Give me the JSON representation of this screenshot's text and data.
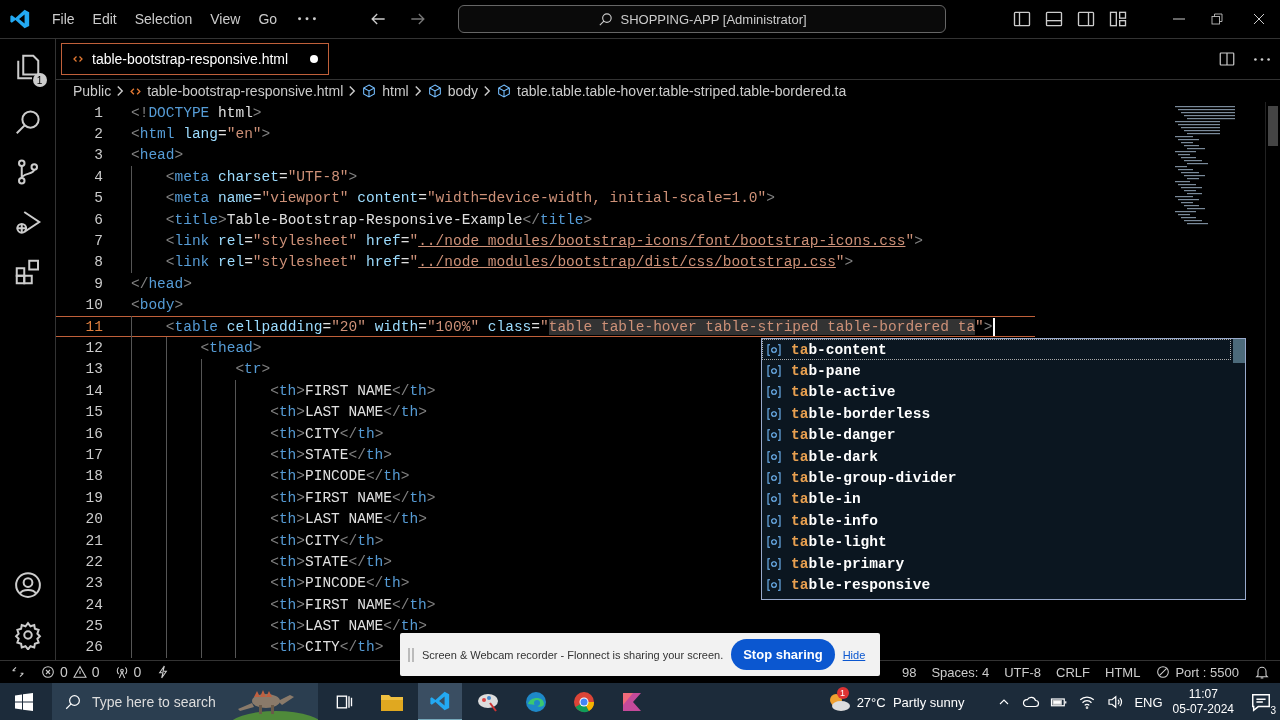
{
  "title_bar": {
    "menu": [
      "File",
      "Edit",
      "Selection",
      "View",
      "Go"
    ],
    "command_center": "SHOPPING-APP [Administrator]"
  },
  "activity_bar": {
    "explorer_badge": "1"
  },
  "tabs": [
    {
      "label": "table-bootstrap-responsive.html",
      "selected": true,
      "modified": true
    }
  ],
  "breadcrumb": [
    {
      "kind": "folder",
      "label": "Public"
    },
    {
      "kind": "file",
      "label": "table-bootstrap-responsive.html"
    },
    {
      "kind": "element",
      "label": "html"
    },
    {
      "kind": "element",
      "label": "body"
    },
    {
      "kind": "element",
      "label": "table.table.table-hover.table-striped.table-bordered.ta"
    }
  ],
  "lines": [
    {
      "number": "1",
      "current": false,
      "tokens": [
        {
          "kind": "punct",
          "text": "<!"
        },
        {
          "kind": "tag",
          "text": "DOCTYPE"
        },
        {
          "kind": "text",
          "text": " html"
        },
        {
          "kind": "punct",
          "text": ">"
        }
      ]
    },
    {
      "number": "2",
      "current": false,
      "tokens": [
        {
          "kind": "punct",
          "text": "<"
        },
        {
          "kind": "tag",
          "text": "html"
        },
        {
          "kind": "attr",
          "text": " lang"
        },
        {
          "kind": "text",
          "text": "="
        },
        {
          "kind": "str",
          "text": "\"en\""
        },
        {
          "kind": "punct",
          "text": ">"
        }
      ]
    },
    {
      "number": "3",
      "current": false,
      "tokens": [
        {
          "kind": "punct",
          "text": "<"
        },
        {
          "kind": "tag",
          "text": "head"
        },
        {
          "kind": "punct",
          "text": ">"
        }
      ],
      "children": [
        {
          "number": "4",
          "current": false,
          "tokens": [
            {
              "kind": "punct",
              "text": "<"
            },
            {
              "kind": "tag",
              "text": "meta"
            },
            {
              "kind": "attr",
              "text": " charset"
            },
            {
              "kind": "text",
              "text": "="
            },
            {
              "kind": "str",
              "text": "\"UTF-8\""
            },
            {
              "kind": "punct",
              "text": ">"
            }
          ]
        },
        {
          "number": "5",
          "current": false,
          "tokens": [
            {
              "kind": "punct",
              "text": "<"
            },
            {
              "kind": "tag",
              "text": "meta"
            },
            {
              "kind": "attr",
              "text": " name"
            },
            {
              "kind": "text",
              "text": "="
            },
            {
              "kind": "str",
              "text": "\"viewport\""
            },
            {
              "kind": "attr",
              "text": " content"
            },
            {
              "kind": "text",
              "text": "="
            },
            {
              "kind": "str",
              "text": "\"width=device-width, initial-scale=1.0\""
            },
            {
              "kind": "punct",
              "text": ">"
            }
          ]
        },
        {
          "number": "6",
          "current": false,
          "tokens": [
            {
              "kind": "punct",
              "text": "<"
            },
            {
              "kind": "tag",
              "text": "title"
            },
            {
              "kind": "punct",
              "text": ">"
            },
            {
              "kind": "text",
              "text": "Table-Bootstrap-Responsive-Example"
            },
            {
              "kind": "punct",
              "text": "</"
            },
            {
              "kind": "tag",
              "text": "title"
            },
            {
              "kind": "punct",
              "text": ">"
            }
          ]
        },
        {
          "number": "7",
          "current": false,
          "tokens": [
            {
              "kind": "punct",
              "text": "<"
            },
            {
              "kind": "tag",
              "text": "link"
            },
            {
              "kind": "attr",
              "text": " rel"
            },
            {
              "kind": "text",
              "text": "="
            },
            {
              "kind": "str",
              "text": "\"stylesheet\""
            },
            {
              "kind": "attr",
              "text": " href"
            },
            {
              "kind": "text",
              "text": "="
            },
            {
              "kind": "str",
              "text": "\""
            },
            {
              "kind": "link",
              "text": "../node_modules/bootstrap-icons/font/bootstrap-icons.css"
            },
            {
              "kind": "str",
              "text": "\""
            },
            {
              "kind": "punct",
              "text": ">"
            }
          ]
        },
        {
          "number": "8",
          "current": false,
          "tokens": [
            {
              "kind": "punct",
              "text": "<"
            },
            {
              "kind": "tag",
              "text": "link"
            },
            {
              "kind": "attr",
              "text": " rel"
            },
            {
              "kind": "text",
              "text": "="
            },
            {
              "kind": "str",
              "text": "\"stylesheet\""
            },
            {
              "kind": "attr",
              "text": " href"
            },
            {
              "kind": "text",
              "text": "="
            },
            {
              "kind": "str",
              "text": "\""
            },
            {
              "kind": "link",
              "text": "../node_modules/bootstrap/dist/css/bootstrap.css"
            },
            {
              "kind": "str",
              "text": "\""
            },
            {
              "kind": "punct",
              "text": ">"
            }
          ]
        }
      ]
    },
    {
      "number": "9",
      "current": false,
      "tokens": [
        {
          "kind": "punct",
          "text": "</"
        },
        {
          "kind": "tag",
          "text": "head"
        },
        {
          "kind": "punct",
          "text": ">"
        }
      ]
    },
    {
      "number": "10",
      "current": false,
      "tokens": [
        {
          "kind": "punct",
          "text": "<"
        },
        {
          "kind": "tag",
          "text": "body"
        },
        {
          "kind": "punct",
          "text": ">"
        }
      ],
      "children": [
        {
          "number": "11",
          "current": true,
          "tokens": [
            {
              "kind": "punct",
              "text": "<"
            },
            {
              "kind": "tag",
              "text": "table"
            },
            {
              "kind": "attr",
              "text": " cellpadding"
            },
            {
              "kind": "text",
              "text": "="
            },
            {
              "kind": "str",
              "text": "\"20\""
            },
            {
              "kind": "attr",
              "text": " width"
            },
            {
              "kind": "text",
              "text": "="
            },
            {
              "kind": "str",
              "text": "\"100%\""
            },
            {
              "kind": "attr",
              "text": " class"
            },
            {
              "kind": "text",
              "text": "="
            },
            {
              "kind": "str",
              "text": "\""
            },
            {
              "kind": "highlight",
              "text": "table table-hover table-striped table-bordered ta"
            },
            {
              "kind": "str",
              "text": "\""
            },
            {
              "kind": "punct",
              "text": ">"
            }
          ],
          "children": [
            {
              "number": "12",
              "current": false,
              "tokens": [
                {
                  "kind": "punct",
                  "text": "<"
                },
                {
                  "kind": "tag",
                  "text": "thead"
                },
                {
                  "kind": "punct",
                  "text": ">"
                }
              ],
              "children": [
                {
                  "number": "13",
                  "current": false,
                  "tokens": [
                    {
                      "kind": "punct",
                      "text": "<"
                    },
                    {
                      "kind": "tag",
                      "text": "tr"
                    },
                    {
                      "kind": "punct",
                      "text": ">"
                    }
                  ],
                  "children": [
                    {
                      "number": "14",
                      "current": false,
                      "tokens": [
                        {
                          "kind": "punct",
                          "text": "<"
                        },
                        {
                          "kind": "tag",
                          "text": "th"
                        },
                        {
                          "kind": "punct",
                          "text": ">"
                        },
                        {
                          "kind": "text",
                          "text": "FIRST NAME"
                        },
                        {
                          "kind": "punct",
                          "text": "</"
                        },
                        {
                          "kind": "tag",
                          "text": "th"
                        },
                        {
                          "kind": "punct",
                          "text": ">"
                        }
                      ]
                    },
                    {
                      "number": "15",
                      "current": false,
                      "tokens": [
                        {
                          "kind": "punct",
                          "text": "<"
                        },
                        {
                          "kind": "tag",
                          "text": "th"
                        },
                        {
                          "kind": "punct",
                          "text": ">"
                        },
                        {
                          "kind": "text",
                          "text": "LAST NAME"
                        },
                        {
                          "kind": "punct",
                          "text": "</"
                        },
                        {
                          "kind": "tag",
                          "text": "th"
                        },
                        {
                          "kind": "punct",
                          "text": ">"
                        }
                      ]
                    },
                    {
                      "number": "16",
                      "current": false,
                      "tokens": [
                        {
                          "kind": "punct",
                          "text": "<"
                        },
                        {
                          "kind": "tag",
                          "text": "th"
                        },
                        {
                          "kind": "punct",
                          "text": ">"
                        },
                        {
                          "kind": "text",
                          "text": "CITY"
                        },
                        {
                          "kind": "punct",
                          "text": "</"
                        },
                        {
                          "kind": "tag",
                          "text": "th"
                        },
                        {
                          "kind": "punct",
                          "text": ">"
                        }
                      ]
                    },
                    {
                      "number": "17",
                      "current": false,
                      "tokens": [
                        {
                          "kind": "punct",
                          "text": "<"
                        },
                        {
                          "kind": "tag",
                          "text": "th"
                        },
                        {
                          "kind": "punct",
                          "text": ">"
                        },
                        {
                          "kind": "text",
                          "text": "STATE"
                        },
                        {
                          "kind": "punct",
                          "text": "</"
                        },
                        {
                          "kind": "tag",
                          "text": "th"
                        },
                        {
                          "kind": "punct",
                          "text": ">"
                        }
                      ]
                    },
                    {
                      "number": "18",
                      "current": false,
                      "tokens": [
                        {
                          "kind": "punct",
                          "text": "<"
                        },
                        {
                          "kind": "tag",
                          "text": "th"
                        },
                        {
                          "kind": "punct",
                          "text": ">"
                        },
                        {
                          "kind": "text",
                          "text": "PINCODE"
                        },
                        {
                          "kind": "punct",
                          "text": "</"
                        },
                        {
                          "kind": "tag",
                          "text": "th"
                        },
                        {
                          "kind": "punct",
                          "text": ">"
                        }
                      ]
                    },
                    {
                      "number": "19",
                      "current": false,
                      "tokens": [
                        {
                          "kind": "punct",
                          "text": "<"
                        },
                        {
                          "kind": "tag",
                          "text": "th"
                        },
                        {
                          "kind": "punct",
                          "text": ">"
                        },
                        {
                          "kind": "text",
                          "text": "FIRST NAME"
                        },
                        {
                          "kind": "punct",
                          "text": "</"
                        },
                        {
                          "kind": "tag",
                          "text": "th"
                        },
                        {
                          "kind": "punct",
                          "text": ">"
                        }
                      ]
                    },
                    {
                      "number": "20",
                      "current": false,
                      "tokens": [
                        {
                          "kind": "punct",
                          "text": "<"
                        },
                        {
                          "kind": "tag",
                          "text": "th"
                        },
                        {
                          "kind": "punct",
                          "text": ">"
                        },
                        {
                          "kind": "text",
                          "text": "LAST NAME"
                        },
                        {
                          "kind": "punct",
                          "text": "</"
                        },
                        {
                          "kind": "tag",
                          "text": "th"
                        },
                        {
                          "kind": "punct",
                          "text": ">"
                        }
                      ]
                    },
                    {
                      "number": "21",
                      "current": false,
                      "tokens": [
                        {
                          "kind": "punct",
                          "text": "<"
                        },
                        {
                          "kind": "tag",
                          "text": "th"
                        },
                        {
                          "kind": "punct",
                          "text": ">"
                        },
                        {
                          "kind": "text",
                          "text": "CITY"
                        },
                        {
                          "kind": "punct",
                          "text": "</"
                        },
                        {
                          "kind": "tag",
                          "text": "th"
                        },
                        {
                          "kind": "punct",
                          "text": ">"
                        }
                      ]
                    },
                    {
                      "number": "22",
                      "current": false,
                      "tokens": [
                        {
                          "kind": "punct",
                          "text": "<"
                        },
                        {
                          "kind": "tag",
                          "text": "th"
                        },
                        {
                          "kind": "punct",
                          "text": ">"
                        },
                        {
                          "kind": "text",
                          "text": "STATE"
                        },
                        {
                          "kind": "punct",
                          "text": "</"
                        },
                        {
                          "kind": "tag",
                          "text": "th"
                        },
                        {
                          "kind": "punct",
                          "text": ">"
                        }
                      ]
                    },
                    {
                      "number": "23",
                      "current": false,
                      "tokens": [
                        {
                          "kind": "punct",
                          "text": "<"
                        },
                        {
                          "kind": "tag",
                          "text": "th"
                        },
                        {
                          "kind": "punct",
                          "text": ">"
                        },
                        {
                          "kind": "text",
                          "text": "PINCODE"
                        },
                        {
                          "kind": "punct",
                          "text": "</"
                        },
                        {
                          "kind": "tag",
                          "text": "th"
                        },
                        {
                          "kind": "punct",
                          "text": ">"
                        }
                      ]
                    },
                    {
                      "number": "24",
                      "current": false,
                      "tokens": [
                        {
                          "kind": "punct",
                          "text": "<"
                        },
                        {
                          "kind": "tag",
                          "text": "th"
                        },
                        {
                          "kind": "punct",
                          "text": ">"
                        },
                        {
                          "kind": "text",
                          "text": "FIRST NAME"
                        },
                        {
                          "kind": "punct",
                          "text": "</"
                        },
                        {
                          "kind": "tag",
                          "text": "th"
                        },
                        {
                          "kind": "punct",
                          "text": ">"
                        }
                      ]
                    },
                    {
                      "number": "25",
                      "current": false,
                      "tokens": [
                        {
                          "kind": "punct",
                          "text": "<"
                        },
                        {
                          "kind": "tag",
                          "text": "th"
                        },
                        {
                          "kind": "punct",
                          "text": ">"
                        },
                        {
                          "kind": "text",
                          "text": "LAST NAME"
                        },
                        {
                          "kind": "punct",
                          "text": "</"
                        },
                        {
                          "kind": "tag",
                          "text": "th"
                        },
                        {
                          "kind": "punct",
                          "text": ">"
                        }
                      ]
                    },
                    {
                      "number": "26",
                      "current": false,
                      "tokens": [
                        {
                          "kind": "punct",
                          "text": "<"
                        },
                        {
                          "kind": "tag",
                          "text": "th"
                        },
                        {
                          "kind": "punct",
                          "text": ">"
                        },
                        {
                          "kind": "text",
                          "text": "CITY"
                        },
                        {
                          "kind": "punct",
                          "text": "</"
                        },
                        {
                          "kind": "tag",
                          "text": "th"
                        },
                        {
                          "kind": "punct",
                          "text": ">"
                        }
                      ]
                    }
                  ]
                }
              ]
            }
          ]
        }
      ]
    }
  ],
  "suggestions": [
    {
      "match": "ta",
      "rest": "b-content",
      "selected": true
    },
    {
      "match": "ta",
      "rest": "b-pane",
      "selected": false
    },
    {
      "match": "ta",
      "rest": "ble-active",
      "selected": false
    },
    {
      "match": "ta",
      "rest": "ble-borderless",
      "selected": false
    },
    {
      "match": "ta",
      "rest": "ble-danger",
      "selected": false
    },
    {
      "match": "ta",
      "rest": "ble-dark",
      "selected": false
    },
    {
      "match": "ta",
      "rest": "ble-group-divider",
      "selected": false
    },
    {
      "match": "ta",
      "rest": "ble-in",
      "selected": false
    },
    {
      "match": "ta",
      "rest": "ble-info",
      "selected": false
    },
    {
      "match": "ta",
      "rest": "ble-light",
      "selected": false
    },
    {
      "match": "ta",
      "rest": "ble-primary",
      "selected": false
    },
    {
      "match": "ta",
      "rest": "ble-responsive",
      "selected": false
    }
  ],
  "status_bar": {
    "errors": "0",
    "warnings": "0",
    "ports": "0",
    "right": [
      {
        "kind": "text",
        "label": "98"
      },
      {
        "kind": "text",
        "label": "Spaces: 4"
      },
      {
        "kind": "text",
        "label": "UTF-8"
      },
      {
        "kind": "text",
        "label": "CRLF"
      },
      {
        "kind": "text",
        "label": "HTML"
      },
      {
        "kind": "port",
        "label": "Port : 5500"
      }
    ]
  },
  "share_banner": {
    "message": "Screen & Webcam recorder - Flonnect is sharing your screen.",
    "stop": "Stop sharing",
    "hide": "Hide"
  },
  "taskbar": {
    "search_placeholder": "Type here to search",
    "weather_badge": "1",
    "weather": "27°C  Partly sunny",
    "language": "ENG",
    "time": "11:07",
    "date": "05-07-2024",
    "notifications": "3"
  }
}
